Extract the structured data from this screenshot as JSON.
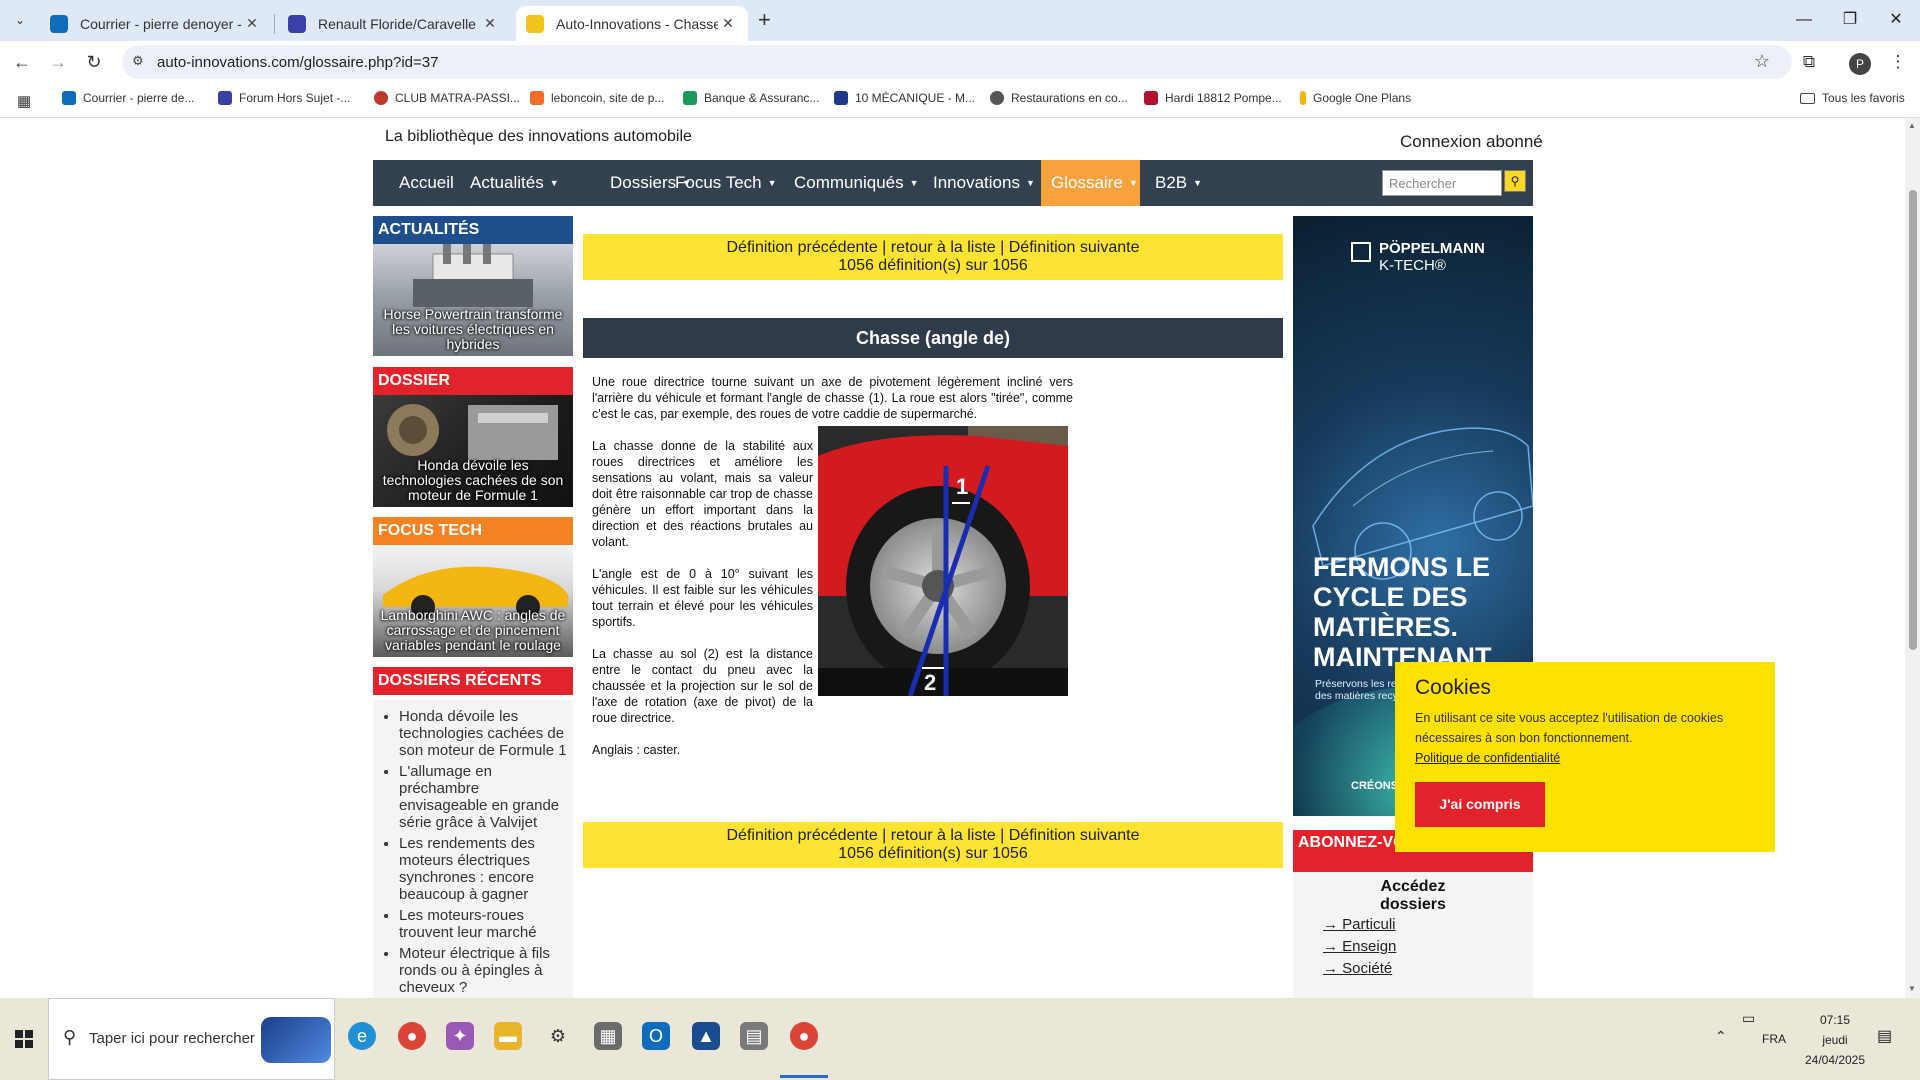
{
  "browser": {
    "tabs": [
      {
        "title": "Courrier - pierre denoyer - Outl",
        "color": "#0f6cbd"
      },
      {
        "title": "Renault Floride/Caravelle [inter",
        "color": "#3b3fa8"
      },
      {
        "title": "Auto-Innovations - Chasse (angl",
        "color": "#f0c419"
      }
    ],
    "url": "auto-innovations.com/glossaire.php?id=37",
    "profile_initial": "P",
    "bookmarks": [
      {
        "label": "Courrier - pierre de...",
        "color": "#0f6cbd"
      },
      {
        "label": "Forum Hors Sujet -...",
        "color": "#3b3fa8"
      },
      {
        "label": "CLUB MATRA-PASSI...",
        "color": "#c0392b"
      },
      {
        "label": "leboncoin, site de p...",
        "color": "#f56b2a"
      },
      {
        "label": "Banque & Assuranc...",
        "color": "#1a9b5b"
      },
      {
        "label": "10 MÉCANIQUE - M...",
        "color": "#1f3a8a"
      },
      {
        "label": "Restaurations en co...",
        "color": "#555555"
      },
      {
        "label": "Hardi 18812 Pompe...",
        "color": "#b3122e"
      },
      {
        "label": "Google One Plans",
        "color": "#f4b400"
      }
    ],
    "all_bookmarks": "Tous les favoris"
  },
  "site": {
    "tagline": "La bibliothèque des innovations automobile",
    "login": "Connexion abonné",
    "nav": [
      {
        "label": "Accueil",
        "caret": ""
      },
      {
        "label": "Actualités",
        "caret": "▼"
      },
      {
        "label": "Dossiers",
        "caret": "▼"
      },
      {
        "label": "Focus Tech",
        "caret": "▼"
      },
      {
        "label": "Communiqués",
        "caret": "▼"
      },
      {
        "label": "Innovations",
        "caret": "▼"
      },
      {
        "label": "Glossaire",
        "caret": "▼"
      },
      {
        "label": "B2B",
        "caret": "▼"
      }
    ],
    "search_placeholder": "Rechercher"
  },
  "sidebar": {
    "blocks": [
      {
        "heading": "ACTUALITÉS",
        "color": "#1e4f8c",
        "caption": "Horse Powertrain transforme les voitures électriques en hybrides"
      },
      {
        "heading": "DOSSIER",
        "color": "#e3232c",
        "caption": "Honda dévoile les technologies cachées de son moteur de Formule 1"
      },
      {
        "heading": "FOCUS TECH",
        "color": "#f58220",
        "caption": "Lamborghini AWC : angles de carrossage et de pincement variables pendant le roulage"
      }
    ],
    "recent_heading": "DOSSIERS RÉCENTS",
    "recent": [
      "Honda dévoile les technologies cachées de son moteur de Formule 1",
      "L'allumage en préchambre envisageable en grande série grâce à Valvijet",
      "Les rendements des moteurs électriques synchrones : encore beaucoup à gagner",
      "Les moteurs-roues trouvent leur marché",
      "Moteur électrique à fils ronds ou à épingles à cheveux ?"
    ]
  },
  "definition": {
    "nav_line": "Définition précédente | retour à la liste | Définition suivante",
    "count": "1056 définition(s) sur 1056",
    "title": "Chasse (angle de)",
    "intro": "Une roue directrice tourne suivant un axe de pivotement légèrement incliné vers l'arrière du véhicule et formant l'angle de chasse (1). La roue est alors \"tirée\", comme c'est le cas, par exemple, des roues de votre caddie de supermarché.",
    "p2": "La chasse donne de la stabilité aux roues directrices et améliore les sensations au volant, mais sa valeur doit être raisonnable car trop de chasse génère un effort important dans la direction et des réactions brutales au volant.",
    "p3": "L'angle est de 0 à 10° suivant les véhicules. Il est faible sur les véhicules tout terrain et élevé pour les véhicules sportifs.",
    "p4": "La chasse au sol (2) est la distance entre le contact du pneu avec la chaussée et la projection sur le sol de l'axe de rotation (axe de pivot) de la roue directrice.",
    "p5": "Anglais : caster.",
    "fig_label_1": "1",
    "fig_label_2": "2"
  },
  "ad": {
    "brand": "PÖPPELMANN",
    "brand_sub": "K-TECH®",
    "headline": [
      "FERMONS LE",
      "CYCLE DES",
      "MATIÈRES.",
      "MAINTENANT."
    ],
    "sub": "Préservons les ressources en utilisant des matières recyclées.",
    "bottom": "CRÉONS"
  },
  "abonnez": {
    "heading": "ABONNEZ-VOUS DOSSIERS",
    "line1": "Accédez",
    "line2": "dossiers",
    "links": [
      "→ Particuli",
      "→ Enseign",
      "→ Société"
    ]
  },
  "cookie": {
    "title": "Cookies",
    "text": "En utilisant ce site vous acceptez l'utilisation de cookies nécessaires à son bon fonctionnement.",
    "link": "Politique de confidentialité",
    "button": "J'ai compris"
  },
  "taskbar": {
    "search": "Taper ici pour rechercher",
    "lang": "FRA",
    "time": "07:15",
    "day": "jeudi",
    "date": "24/04/2025"
  }
}
